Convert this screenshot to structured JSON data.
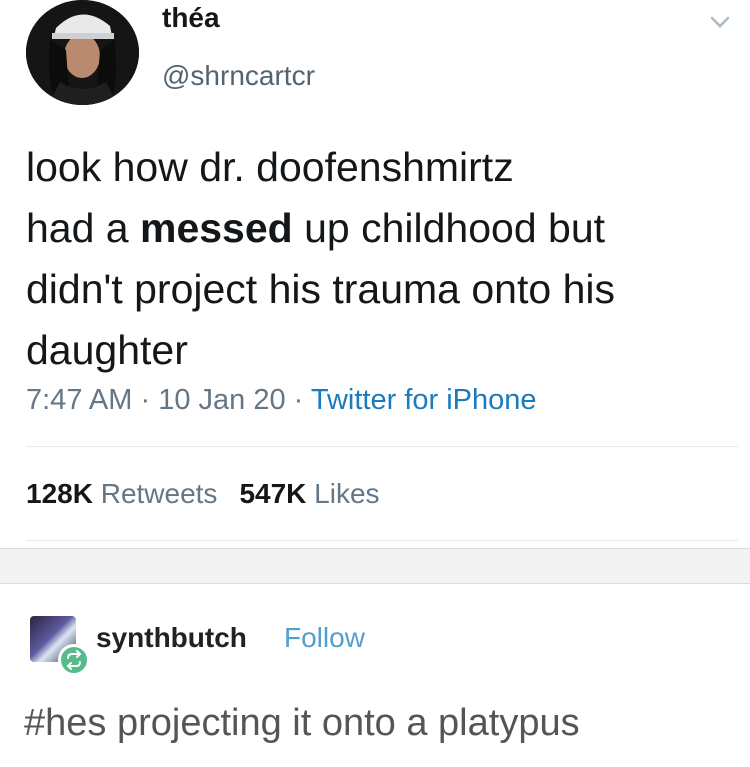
{
  "tweet": {
    "display_name": "théa",
    "handle": "@shrncartcr",
    "text_lines": [
      {
        "before": "look how dr. doofenshmirtz",
        "bold": "",
        "after": ""
      },
      {
        "before": "had a ",
        "bold": "messed",
        "after": " up childhood but"
      },
      {
        "before": "didn't project his trauma onto his",
        "bold": "",
        "after": ""
      },
      {
        "before": "daughter",
        "bold": "",
        "after": ""
      }
    ],
    "time": "7:47 AM",
    "date": "10 Jan 20",
    "separator": "·",
    "source": "Twitter for iPhone",
    "retweets_count": "128K",
    "retweets_label": "Retweets",
    "likes_count": "547K",
    "likes_label": "Likes",
    "chevron_icon": "chevron-down-icon"
  },
  "reblog": {
    "blog_name": "synthbutch",
    "follow_label": "Follow",
    "tags": "#hes projecting it onto a platypus",
    "badge_icon": "reblog-icon",
    "accent_color": "#529ecc"
  }
}
